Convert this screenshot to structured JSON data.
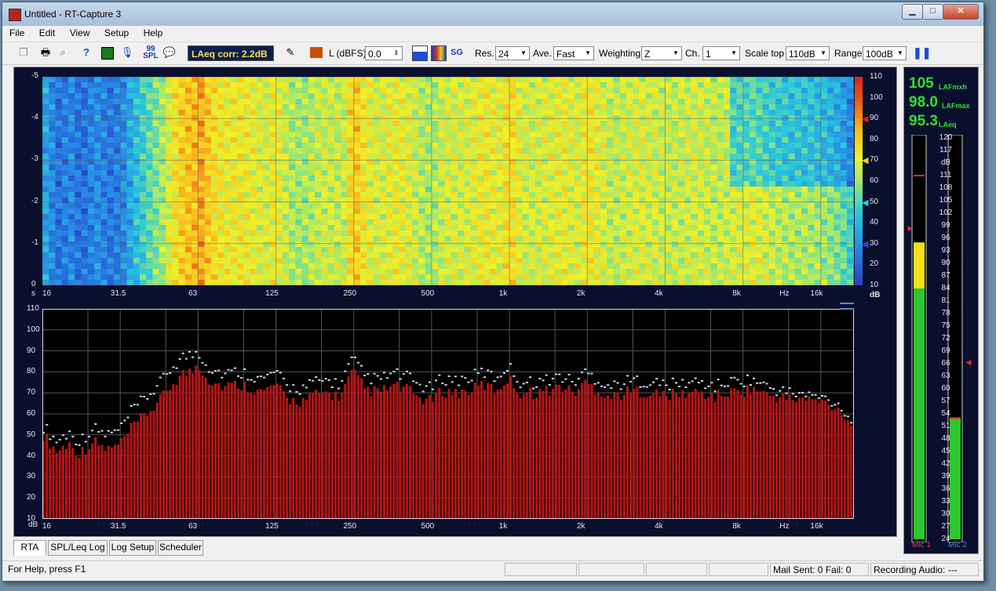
{
  "window": {
    "title": "Untitled - RT-Capture 3"
  },
  "menu": [
    "File",
    "Edit",
    "View",
    "Setup",
    "Help"
  ],
  "toolbar": {
    "laeq_corr": "LAeq corr: 2.2dB",
    "level_label": "L (dBFS)",
    "level_value": "0.0",
    "spl_icon": "99 SPL",
    "sg_icon": "SG",
    "res_label": "Res.",
    "res_value": "24",
    "ave_label": "Ave.",
    "ave_value": "Fast",
    "weighting_label": "Weighting",
    "weighting_value": "Z",
    "ch_label": "Ch.",
    "ch_value": "1",
    "scale_top_label": "Scale top",
    "scale_top_value": "110dB",
    "range_label": "Range",
    "range_value": "100dB"
  },
  "spectrogram": {
    "y_axis_ticks": [
      "-5",
      "-4",
      "-3",
      "-2",
      "-1",
      "0"
    ],
    "y_unit": "s",
    "colorbar_ticks": [
      "110",
      "100",
      "90",
      "80",
      "70",
      "60",
      "50",
      "40",
      "30",
      "20",
      "10"
    ],
    "colorbar_unit": "dB",
    "colorbar_markers": [
      90,
      70,
      50,
      30
    ]
  },
  "freq_axis": {
    "labels": [
      "16",
      "31.5",
      "63",
      "125",
      "250",
      "500",
      "1k",
      "2k",
      "4k",
      "8k",
      "16k"
    ],
    "unit": "Hz"
  },
  "chart_data": {
    "type": "bar",
    "title": "",
    "xlabel": "Hz",
    "ylabel": "dB",
    "xscale": "log",
    "xlim_hz": [
      16,
      22000
    ],
    "ylim": [
      10,
      110
    ],
    "y_ticks": [
      "110",
      "100",
      "90",
      "80",
      "70",
      "60",
      "50",
      "40",
      "30",
      "20",
      "10"
    ],
    "bands_per_octave": 24,
    "bar_color": "#b01515",
    "peak_color": "#c8d4e6",
    "anchors_hz": [
      16,
      18,
      20,
      22,
      25,
      28,
      31.5,
      35,
      40,
      45,
      50,
      55,
      60,
      63,
      70,
      80,
      90,
      100,
      112,
      125,
      140,
      160,
      180,
      200,
      225,
      250,
      280,
      315,
      355,
      400,
      450,
      500,
      560,
      630,
      710,
      800,
      900,
      1000,
      1120,
      1250,
      1400,
      1600,
      1800,
      2000,
      2240,
      2500,
      2800,
      3150,
      3550,
      4000,
      4500,
      5000,
      5600,
      6300,
      7100,
      8000,
      9000,
      10000,
      11200,
      12500,
      14000,
      16000,
      18000,
      20000,
      22000
    ],
    "anchors_db": [
      50,
      42,
      46,
      41,
      47,
      43,
      45,
      53,
      60,
      66,
      74,
      79,
      80,
      84,
      76,
      73,
      74,
      73,
      70,
      74,
      67,
      66,
      69,
      70,
      68,
      80,
      72,
      70,
      73,
      72,
      68,
      66,
      71,
      70,
      71,
      74,
      71,
      77,
      70,
      70,
      71,
      73,
      70,
      75,
      71,
      68,
      70,
      71,
      70,
      69,
      69,
      70,
      70,
      68,
      70,
      71,
      72,
      69,
      68,
      67,
      67,
      66,
      64,
      60,
      52
    ],
    "peak_offset_db": [
      4,
      5,
      5,
      6,
      6,
      7,
      7,
      8,
      8,
      8,
      8,
      8,
      8,
      6,
      6,
      6,
      6,
      6,
      6,
      6,
      6,
      6,
      6,
      6,
      6,
      6,
      6,
      6,
      6,
      6,
      6,
      6,
      6,
      6,
      6,
      6,
      6,
      6,
      5,
      5,
      5,
      5,
      5,
      5,
      5,
      5,
      5,
      5,
      5,
      5,
      5,
      5,
      5,
      5,
      5,
      5,
      4,
      4,
      3,
      3,
      2,
      2,
      2,
      2,
      1
    ]
  },
  "meters": {
    "big_values": [
      {
        "value": "105",
        "label": "LAFmxh"
      },
      {
        "value": "98.0",
        "label": "LAFmax"
      },
      {
        "value": "95.3",
        "label": "LAeq"
      }
    ],
    "scale_ticks": [
      "120",
      "117",
      "dB",
      "111",
      "108",
      "105",
      "102",
      "99",
      "96",
      "93",
      "90",
      "87",
      "84",
      "81",
      "78",
      "75",
      "72",
      "69",
      "66",
      "63",
      "60",
      "57",
      "54",
      "51",
      "48",
      "45",
      "42",
      "39",
      "36",
      "33",
      "30",
      "27",
      "24"
    ],
    "scale_min": 24,
    "scale_max": 120,
    "mic1": {
      "label": "Mic 1",
      "level_db": 95,
      "peak_db": 111,
      "marker_db": 98
    },
    "mic2": {
      "label": "Mic 2",
      "level_db": 53,
      "peak_db": 53,
      "marker_db": 66
    }
  },
  "tabs": [
    "RTA",
    "SPL/Leq Log",
    "Log Setup",
    "Scheduler"
  ],
  "status": {
    "help": "For Help, press F1",
    "mail": "Mail Sent: 0  Fail: 0",
    "recording": "Recording Audio: ---"
  }
}
